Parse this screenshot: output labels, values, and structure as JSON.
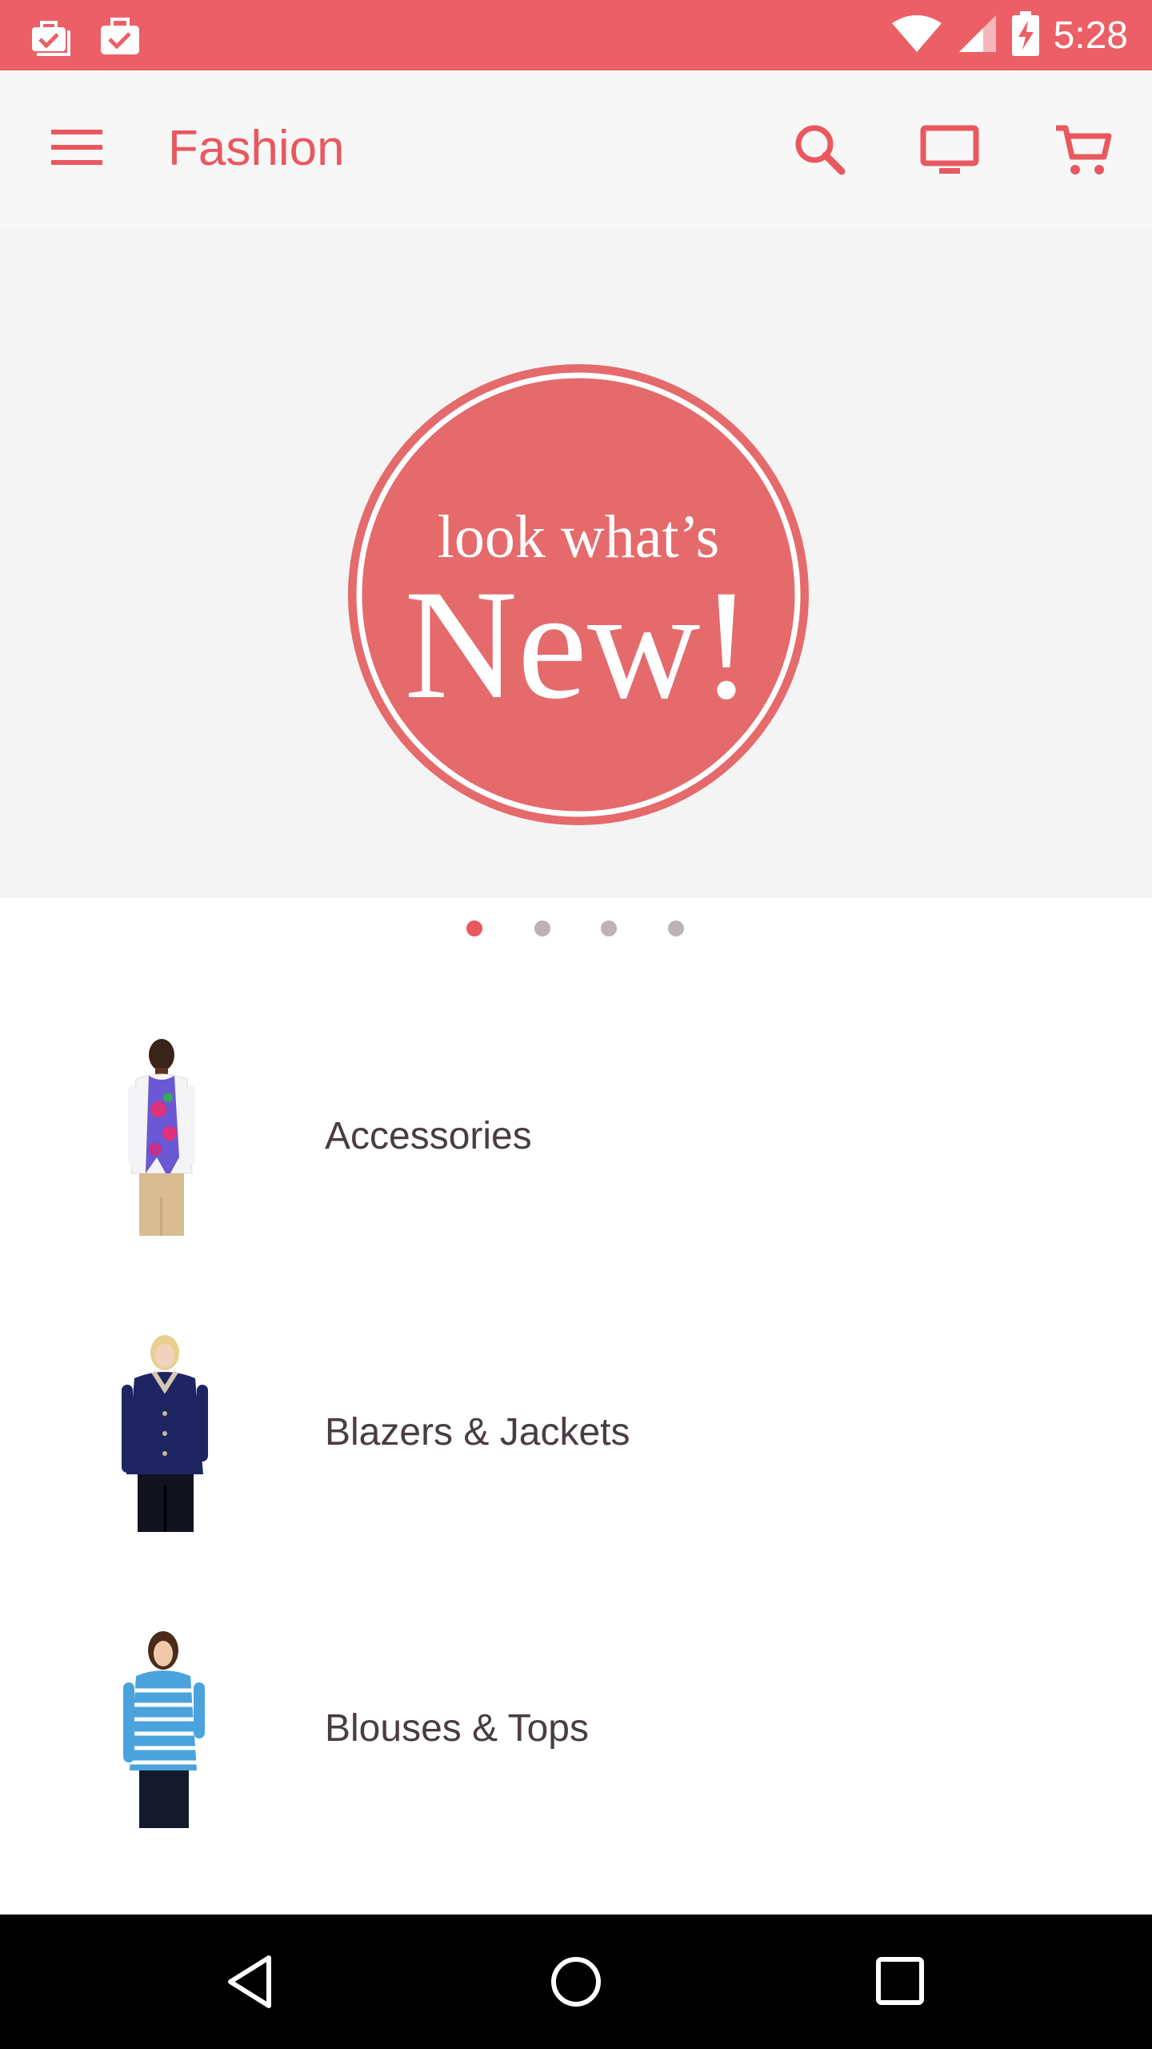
{
  "status_bar": {
    "time": "5:28",
    "notification_icons": [
      "briefcase-check-stack-icon",
      "briefcase-check-icon"
    ],
    "system_icons": [
      "wifi-icon",
      "cell-signal-icon",
      "battery-charging-icon"
    ]
  },
  "app_bar": {
    "title": "Fashion",
    "icons": [
      "menu-icon",
      "search-icon",
      "tv-icon",
      "cart-icon"
    ]
  },
  "hero": {
    "line1": "look what’s",
    "line2": "New!",
    "page_count": 4,
    "active_page": 1
  },
  "categories": [
    {
      "label": "Accessories"
    },
    {
      "label": "Blazers & Jackets"
    },
    {
      "label": "Blouses & Tops"
    }
  ],
  "nav_bar": {
    "icons": [
      "back-icon",
      "home-icon",
      "recents-icon"
    ]
  },
  "colors": {
    "accent": "#e9585f",
    "status_bar": "#ec5f66",
    "app_bar_bg": "#f7f7f7",
    "hero_bg": "#f5f4f4",
    "badge": "#e56a6b",
    "text": "#4a3c45",
    "dot_inactive": "#bbb3b8"
  }
}
